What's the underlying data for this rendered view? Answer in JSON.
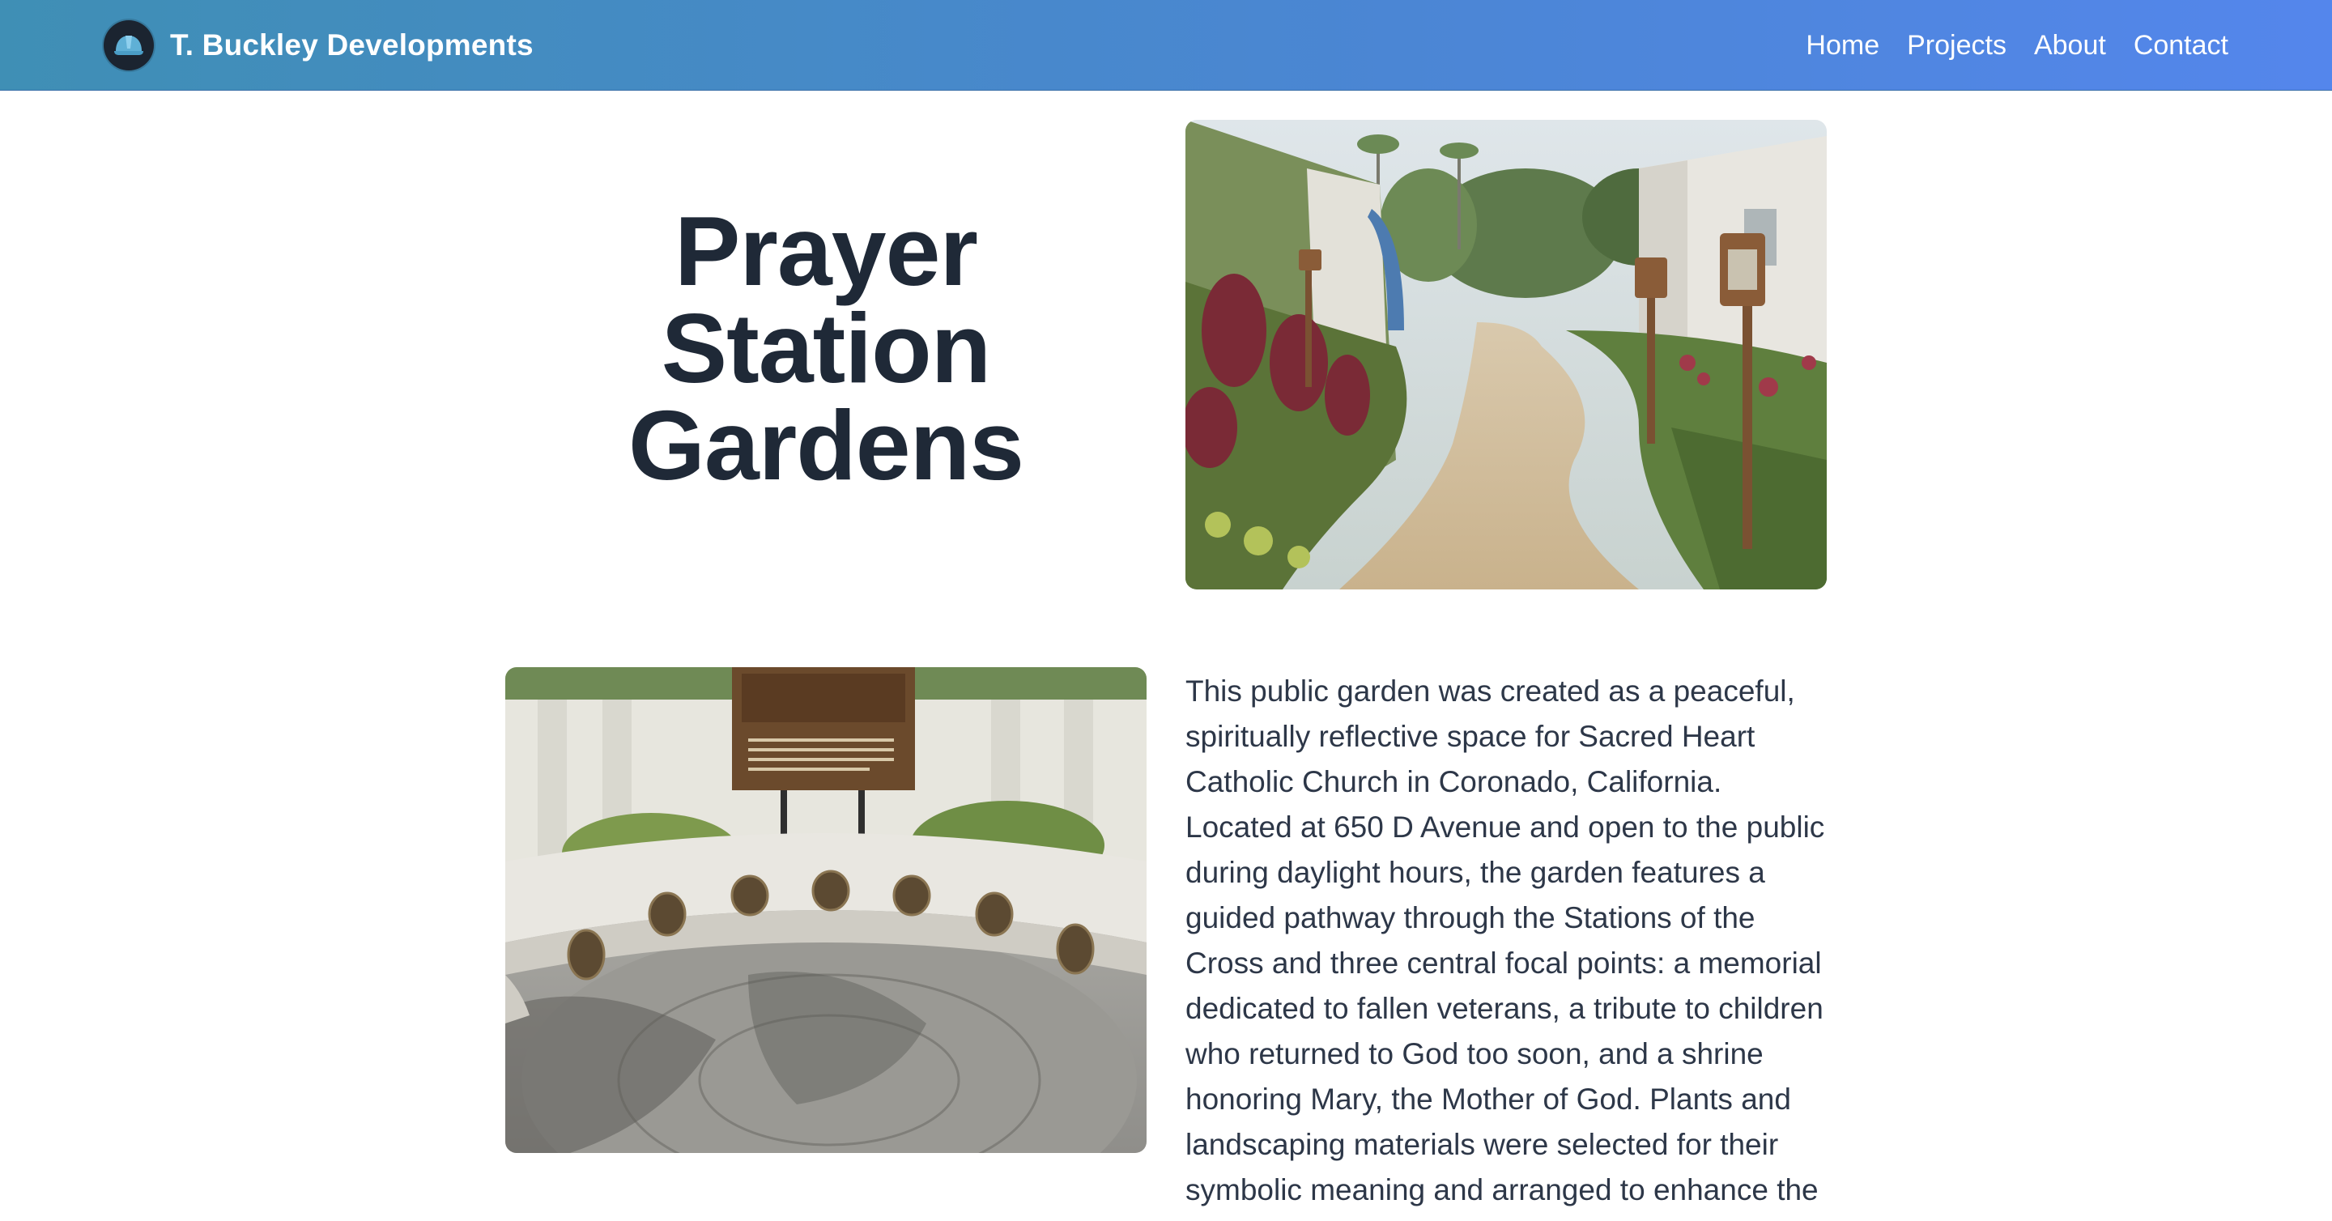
{
  "header": {
    "brand_name": "T. Buckley Developments",
    "logo_icon": "hard-hat-icon",
    "nav": [
      {
        "label": "Home"
      },
      {
        "label": "Projects"
      },
      {
        "label": "About"
      },
      {
        "label": "Contact"
      }
    ]
  },
  "project": {
    "title": "Prayer Station Gardens",
    "description": "This public garden was created as a peaceful, spiritually reflective space for Sacred Heart Catholic Church in Coronado, California. Located at 650 D Avenue and open to the public during daylight hours, the garden features a guided pathway through the Stations of the Cross and three central focal points: a memorial dedicated to fallen veterans, a tribute to children who returned to God too soon, and a shrine honoring Mary, the Mother of God. Plants and landscaping materials were selected for their symbolic meaning and arranged to enhance the"
  },
  "colors": {
    "nav_gradient_start": "#3f8fb5",
    "nav_gradient_end": "#5486ec",
    "title_text": "#1f2937",
    "body_text": "#2d3748"
  }
}
